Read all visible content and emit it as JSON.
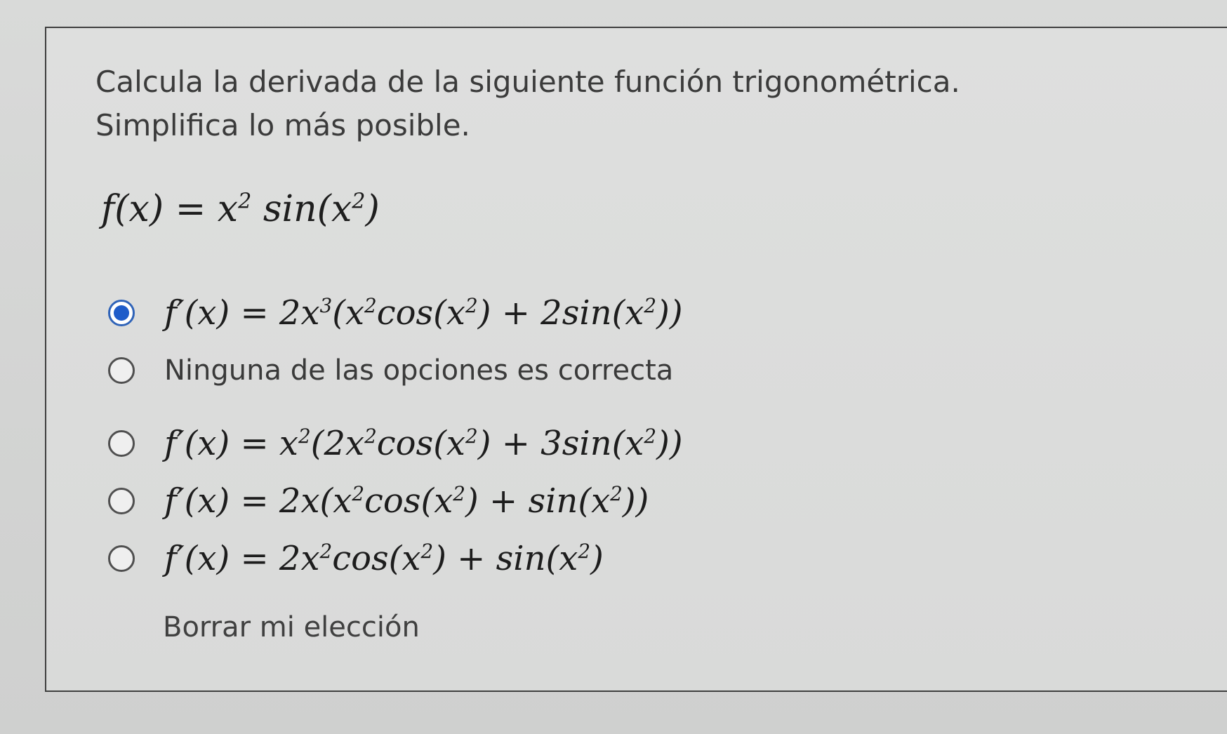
{
  "question": {
    "prompt_line_1": "Calcula la derivada de la siguiente función trigonométrica.",
    "prompt_line_2": "Simplifica lo más posible.",
    "function": {
      "lhs": "f(x)",
      "equals": "=",
      "rhs_prefix": "x",
      "rhs_exp": "2",
      "rhs_mid": "sin(x",
      "rhs_exp2": "2",
      "rhs_suffix": ")"
    }
  },
  "options": [
    {
      "selected": true,
      "parts": {
        "a": "f′(x) = 2x",
        "b": "3",
        "c": "(x",
        "d": "2",
        "e": "cos(x",
        "f": "2",
        "g": ") + 2sin(x",
        "h": "2",
        "i": "))"
      }
    },
    {
      "selected": false,
      "text": "Ninguna de las opciones es correcta"
    },
    {
      "selected": false,
      "parts": {
        "a": "f′(x) = x",
        "b": "2",
        "c": "(2x",
        "d": "2",
        "e": "cos(x",
        "f": "2",
        "g": ") + 3sin(x",
        "h": "2",
        "i": "))"
      }
    },
    {
      "selected": false,
      "parts": {
        "a": "f′(x) = 2x(x",
        "b": "2",
        "c": "cos(x",
        "d": "2",
        "e": ") + sin(x",
        "f": "2",
        "g": "))"
      }
    },
    {
      "selected": false,
      "parts": {
        "a": "f′(x) = 2x",
        "b": "2",
        "c": "cos(x",
        "d": "2",
        "e": ") + sin(x",
        "f": "2",
        "g": ")"
      }
    }
  ],
  "clear_choice": "Borrar mi elección",
  "colors": {
    "selected_radio": "#1f5cc9",
    "text": "#1d1d1d"
  }
}
